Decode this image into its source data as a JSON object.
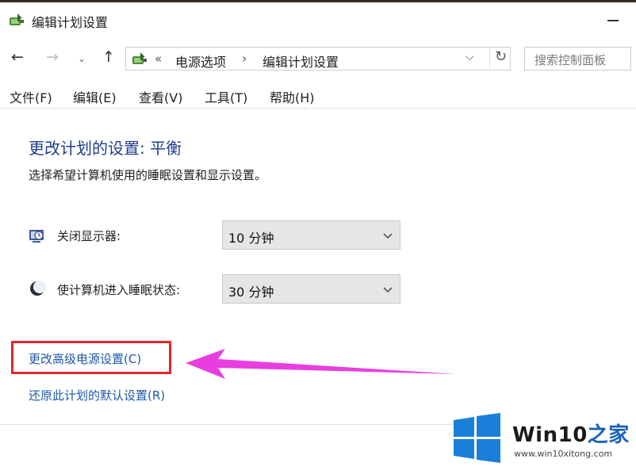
{
  "window": {
    "title": "编辑计划设置"
  },
  "nav": {
    "back_icon": "arrow-left-icon",
    "forward_icon": "arrow-right-icon",
    "recent_icon": "chevron-down-icon",
    "up_icon": "arrow-up-icon",
    "address": {
      "overflow_chevron": "«",
      "crumbs": [
        "电源选项",
        "编辑计划设置"
      ],
      "separator": "›"
    },
    "search_placeholder": "搜索控制面板"
  },
  "menu": [
    "文件(F)",
    "编辑(E)",
    "查看(V)",
    "工具(T)",
    "帮助(H)"
  ],
  "main": {
    "heading": "更改计划的设置: 平衡",
    "subtitle": "选择希望计算机使用的睡眠设置和显示设置。",
    "settings": [
      {
        "label": "关闭显示器:",
        "value": "10 分钟",
        "icon": "monitor-power-icon"
      },
      {
        "label": "使计算机进入睡眠状态:",
        "value": "30 分钟",
        "icon": "sleep-moon-icon"
      }
    ],
    "links": [
      "更改高级电源设置(C)",
      "还原此计划的默认设置(R)"
    ]
  },
  "annotation": {
    "box_color": "#e0272e",
    "arrow_color": "#e83ee0"
  },
  "watermark": {
    "title_prefix": "Win10",
    "title_suffix": "之家",
    "url": "www.win10xitong.com",
    "accent": "#1a62b8"
  }
}
